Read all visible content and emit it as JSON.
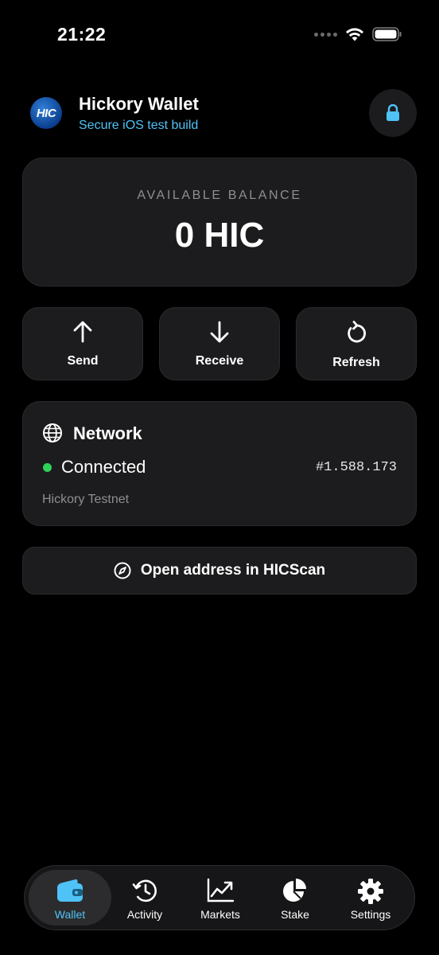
{
  "status_bar": {
    "time": "21:22"
  },
  "header": {
    "logo_text": "HIC",
    "title": "Hickory Wallet",
    "subtitle": "Secure iOS test build",
    "lock_icon": "lock-icon"
  },
  "balance": {
    "label": "AVAILABLE BALANCE",
    "value": "0 HIC"
  },
  "actions": [
    {
      "label": "Send",
      "icon": "arrow-up-icon"
    },
    {
      "label": "Receive",
      "icon": "arrow-down-icon"
    },
    {
      "label": "Refresh",
      "icon": "refresh-icon"
    }
  ],
  "network": {
    "title": "Network",
    "status": "Connected",
    "block": "#1.588.173",
    "name": "Hickory Testnet"
  },
  "explorer": {
    "label": "Open address in HICScan"
  },
  "tabs": [
    {
      "label": "Wallet",
      "icon": "wallet-icon",
      "active": true
    },
    {
      "label": "Activity",
      "icon": "clock-icon",
      "active": false
    },
    {
      "label": "Markets",
      "icon": "chart-icon",
      "active": false
    },
    {
      "label": "Stake",
      "icon": "pie-chart-icon",
      "active": false
    },
    {
      "label": "Settings",
      "icon": "gear-icon",
      "active": false
    }
  ],
  "colors": {
    "accent": "#4fc3f7",
    "connected": "#30d158",
    "card": "#1c1c1e",
    "background": "#000000"
  }
}
